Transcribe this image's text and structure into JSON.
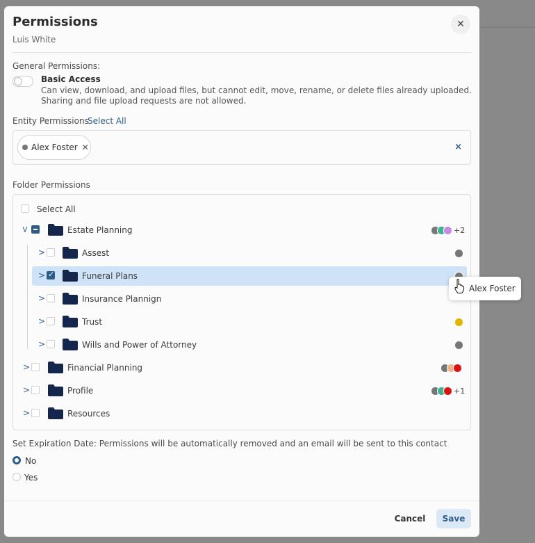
{
  "dialog": {
    "title": "Permissions",
    "subtitle": "Luis White",
    "close_icon": "close-icon"
  },
  "general": {
    "label": "General Permissions:",
    "basic_access_title": "Basic Access",
    "basic_access_desc": "Can view, download, and upload files, but cannot edit, move, rename, or delete files already uploaded. Sharing and file upload requests are not allowed.",
    "basic_access_on": false
  },
  "entity": {
    "label": "Entity Permissions",
    "select_all": "Select All",
    "chips": [
      {
        "name": "Alex Foster",
        "color": "#777777"
      }
    ],
    "clear_icon": "×"
  },
  "folders": {
    "label": "Folder Permissions",
    "select_all": "Select All",
    "items": [
      {
        "name": "Estate Planning",
        "expanded": true,
        "state": "partial",
        "more": "+2",
        "avatars": [
          "#777777",
          "#3fb28f",
          "#c58be0"
        ]
      },
      {
        "name": "Assest",
        "state": "unchecked",
        "avatars": [
          "#777777"
        ]
      },
      {
        "name": "Funeral Plans",
        "state": "checked",
        "selected": true,
        "avatars": [
          "#777777"
        ]
      },
      {
        "name": "Insurance Plannign",
        "state": "unchecked",
        "avatars": []
      },
      {
        "name": "Trust",
        "state": "unchecked",
        "avatars": [
          "#e0b400"
        ]
      },
      {
        "name": "Wills and Power of Attorney",
        "state": "unchecked",
        "avatars": [
          "#777777"
        ]
      },
      {
        "name": "Financial Planning",
        "state": "unchecked",
        "avatars": [
          "#777777",
          "#f0b48a",
          "#d81414"
        ]
      },
      {
        "name": "Profile",
        "state": "unchecked",
        "more": "+1",
        "avatars": [
          "#777777",
          "#3fb28f",
          "#d81414"
        ]
      },
      {
        "name": "Resources",
        "state": "unchecked",
        "avatars": []
      }
    ]
  },
  "tooltip": {
    "name": "Alex Foster"
  },
  "expiration": {
    "label": "Set Expiration Date: Permissions will be automatically removed and an email will be sent to this contact",
    "options": [
      "No",
      "Yes"
    ],
    "selected": "No"
  },
  "footer": {
    "cancel": "Cancel",
    "save": "Save"
  },
  "colors": {
    "accent": "#2f5d8a",
    "folder": "#15264d",
    "selected_row": "#cfe3f8"
  }
}
